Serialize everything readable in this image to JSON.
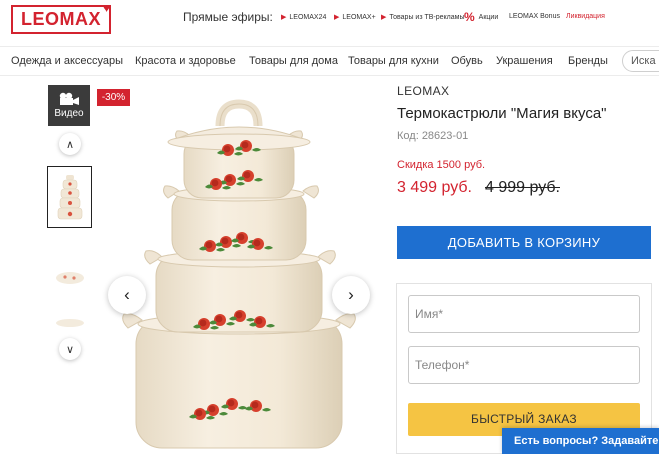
{
  "header": {
    "logo_text": "LEOMAX",
    "live_label": "Прямые эфиры:",
    "live_links": [
      {
        "label": "LEOMAX24"
      },
      {
        "label": "LEOMAX+"
      },
      {
        "label": "Товары из ТВ-рекламы"
      }
    ],
    "promo_label": "Акции",
    "bonus_label": "LEOMAX Bonus",
    "liquidation_label": "Ликвидация"
  },
  "nav": {
    "items": [
      {
        "label": "Одежда и аксессуары"
      },
      {
        "label": "Красота и здоровье"
      },
      {
        "label": "Товары для дома"
      },
      {
        "label": "Товары для кухни"
      },
      {
        "label": "Обувь"
      },
      {
        "label": "Украшения"
      },
      {
        "label": "Бренды"
      }
    ],
    "search_placeholder": "Иска"
  },
  "gallery": {
    "video_label": "Видео",
    "discount_badge": "-30%"
  },
  "product": {
    "brand": "LEOMAX",
    "title": "Термокастрюли \"Магия вкуса\"",
    "code": "Код: 28623-01",
    "discount_text": "Скидка 1500 руб.",
    "price": "3 499 руб.",
    "old_price": "4 999 руб.",
    "add_to_cart": "ДОБАВИТЬ В КОРЗИНУ"
  },
  "quick_order": {
    "name_placeholder": "Имя*",
    "phone_placeholder": "Телефон*",
    "button": "БЫСТРЫЙ ЗАКАЗ"
  },
  "chat": {
    "label": "Есть вопросы? Задавайте!"
  },
  "colors": {
    "brand_red": "#d3232f",
    "primary_blue": "#1e6fd0",
    "cta_yellow": "#f5c443"
  }
}
